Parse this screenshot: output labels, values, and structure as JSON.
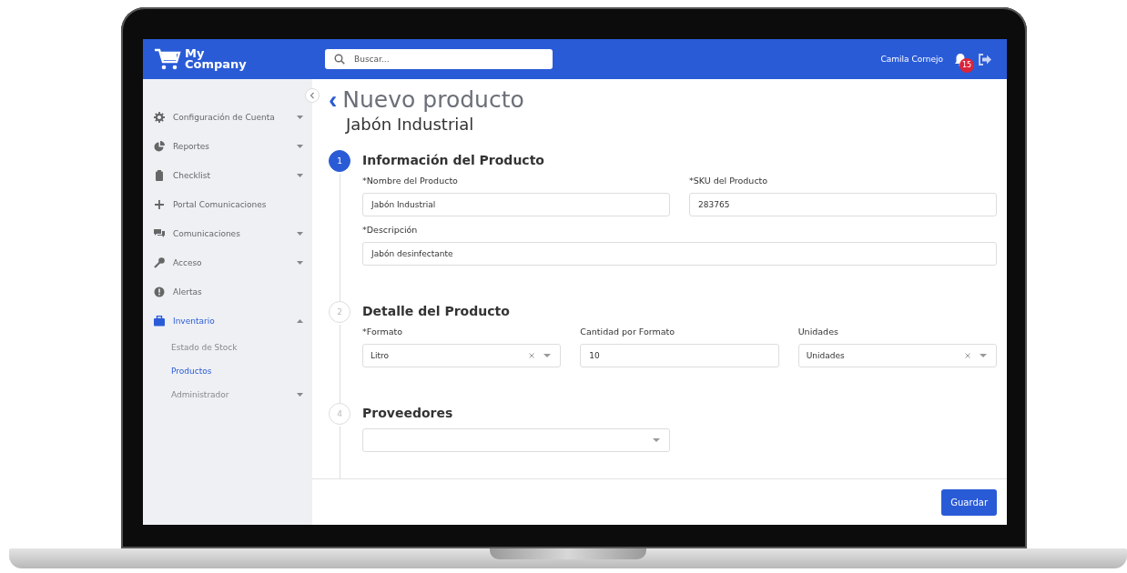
{
  "header": {
    "logo": {
      "line1": "My",
      "line2": "Company"
    },
    "search": {
      "placeholder": "Buscar..."
    },
    "user": "Camila Cornejo",
    "notifications": "15"
  },
  "sidebar": {
    "items": [
      {
        "label": "Configuración de Cuenta",
        "expandable": true,
        "expanded": false,
        "selected": false
      },
      {
        "label": "Reportes",
        "expandable": true,
        "expanded": false,
        "selected": false
      },
      {
        "label": "Checklist",
        "expandable": true,
        "expanded": false,
        "selected": false
      },
      {
        "label": "Portal Comunicaciones",
        "expandable": false,
        "selected": false
      },
      {
        "label": "Comunicaciones",
        "expandable": true,
        "expanded": false,
        "selected": false
      },
      {
        "label": "Acceso",
        "expandable": true,
        "expanded": false,
        "selected": false
      },
      {
        "label": "Alertas",
        "expandable": false,
        "selected": false
      },
      {
        "label": "Inventario",
        "expandable": true,
        "expanded": true,
        "selected": true,
        "children": [
          {
            "label": "Estado de Stock",
            "expandable": false,
            "selected": false
          },
          {
            "label": "Productos",
            "expandable": false,
            "selected": true
          },
          {
            "label": "Administrador",
            "expandable": true,
            "selected": false
          }
        ]
      }
    ]
  },
  "page": {
    "back": "‹",
    "title": "Nuevo producto",
    "subtitle": "Jabón Industrial",
    "steps": [
      {
        "number": "1",
        "active": true,
        "title": "Información del Producto",
        "rows": [
          [
            {
              "kind": "text",
              "label": "*Nombre del Producto",
              "value": "Jabón Industrial"
            },
            {
              "kind": "text",
              "label": "*SKU del Producto",
              "value": "283765"
            }
          ],
          [
            {
              "kind": "text",
              "label": "*Descripción",
              "value": "Jabón desinfectante"
            }
          ]
        ]
      },
      {
        "number": "2",
        "active": false,
        "title": "Detalle del Producto",
        "rows": [
          [
            {
              "kind": "select",
              "label": "*Formato",
              "value": "Litro",
              "clearable": true
            },
            {
              "kind": "text",
              "label": "Cantidad por Formato",
              "value": "10"
            },
            {
              "kind": "select",
              "label": "Unidades",
              "value": "Unidades",
              "clearable": true
            }
          ]
        ]
      },
      {
        "number": "4",
        "active": false,
        "title": "Proveedores",
        "rows": [
          [
            {
              "kind": "select",
              "clearable": false
            }
          ]
        ]
      }
    ]
  },
  "footer": {
    "save": "Guardar"
  }
}
